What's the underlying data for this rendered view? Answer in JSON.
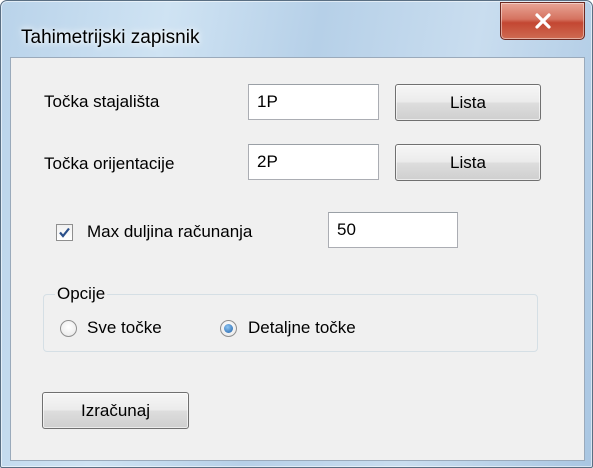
{
  "window": {
    "title": "Tahimetrijski zapisnik",
    "close_icon": "close-icon"
  },
  "form": {
    "station_point": {
      "label": "Točka stajališta",
      "value": "1P",
      "button_label": "Lista"
    },
    "orientation_point": {
      "label": "Točka orijentacije",
      "value": "2P",
      "button_label": "Lista"
    },
    "max_length": {
      "label": "Max duljina računanja",
      "checked": true,
      "value": "50"
    },
    "options": {
      "legend": "Opcije",
      "choices": [
        {
          "label": "Sve točke",
          "selected": false
        },
        {
          "label": "Detaljne točke",
          "selected": true
        }
      ]
    },
    "calculate_button": "Izračunaj"
  },
  "colors": {
    "titlebar": "#c2d9ee",
    "close_button": "#c84b33",
    "dialog_background": "#f0f0f0",
    "radio_selected": "#1e5fa8"
  }
}
